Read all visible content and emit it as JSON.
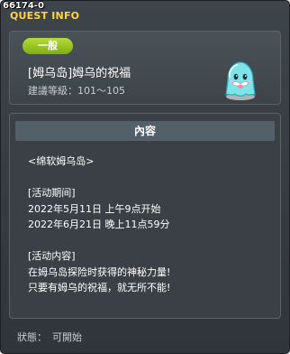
{
  "window": {
    "id_label": "66174-0",
    "title": "QUEST INFO"
  },
  "quest": {
    "category": "一般",
    "name": "[姆乌岛]姆乌的祝福",
    "level_label": "建議等級：",
    "level_range": "101～105"
  },
  "content": {
    "header": "內容",
    "lines": [
      "<绵软姆乌岛>",
      "",
      "[活动期间]",
      "2022年5月11日 上午9点开始",
      "2022年6月21日 晚上11点59分",
      "",
      "[活动内容]",
      "在姆乌岛探险时获得的神秘力量!",
      "只要有姆乌的祝福，就无所不能!"
    ]
  },
  "status": {
    "label": "狀態：",
    "value": "可開始"
  },
  "npc_icon": "muu-ghost-icon"
}
